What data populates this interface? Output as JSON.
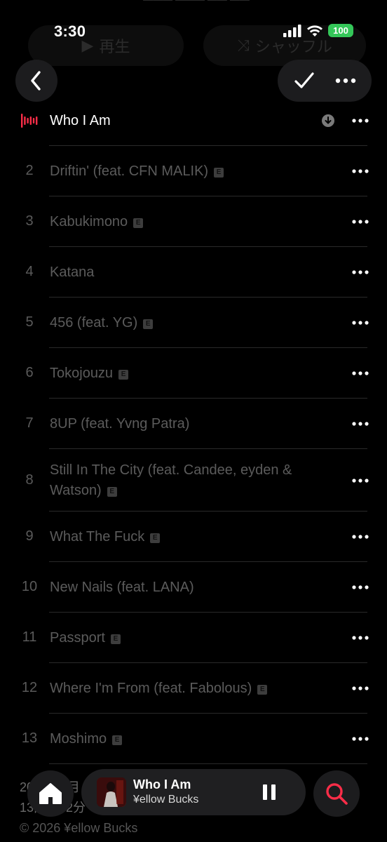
{
  "ghost": {
    "top_text": "▬▬▬ ▬▬▬ ▬▬ ▬▬",
    "play_label": "再生",
    "shuffle_label": "シャッフル"
  },
  "status": {
    "time": "3:30",
    "battery": "100"
  },
  "nav": {
    "back_icon": "chevron-left-icon",
    "check_icon": "checkmark-icon",
    "more_icon": "ellipsis-icon"
  },
  "tracks": [
    {
      "number": "",
      "title": "Who I Am",
      "explicit": false,
      "playing": true,
      "downloaded": true
    },
    {
      "number": "2",
      "title": "Driftin' (feat. CFN MALIK)",
      "explicit": true
    },
    {
      "number": "3",
      "title": "Kabukimono",
      "explicit": true
    },
    {
      "number": "4",
      "title": "Katana",
      "explicit": false
    },
    {
      "number": "5",
      "title": "456 (feat. YG)",
      "explicit": true
    },
    {
      "number": "6",
      "title": "Tokojouzu",
      "explicit": true
    },
    {
      "number": "7",
      "title": "8UP (feat. Yvng Patra)",
      "explicit": false
    },
    {
      "number": "8",
      "title": "Still In The City (feat. Candee, eyden & Watson)",
      "explicit": true
    },
    {
      "number": "9",
      "title": "What The Fuck",
      "explicit": true
    },
    {
      "number": "10",
      "title": "New Nails (feat. LANA)",
      "explicit": false
    },
    {
      "number": "11",
      "title": "Passport",
      "explicit": true
    },
    {
      "number": "12",
      "title": "Where I'm From (feat. Fabolous)",
      "explicit": true
    },
    {
      "number": "13",
      "title": "Moshimo",
      "explicit": true
    }
  ],
  "explicit_badge": "E",
  "footer": {
    "line1": "2026年1月",
    "line2": "13曲、42分",
    "line3": "© 2026 ¥ellow Bucks"
  },
  "mini_player": {
    "title": "Who I Am",
    "artist": "¥ellow Bucks"
  },
  "colors": {
    "accent": "#fa2d48",
    "background": "#000000",
    "dimmed_text": "#5b5b5b",
    "battery": "#34c759"
  }
}
